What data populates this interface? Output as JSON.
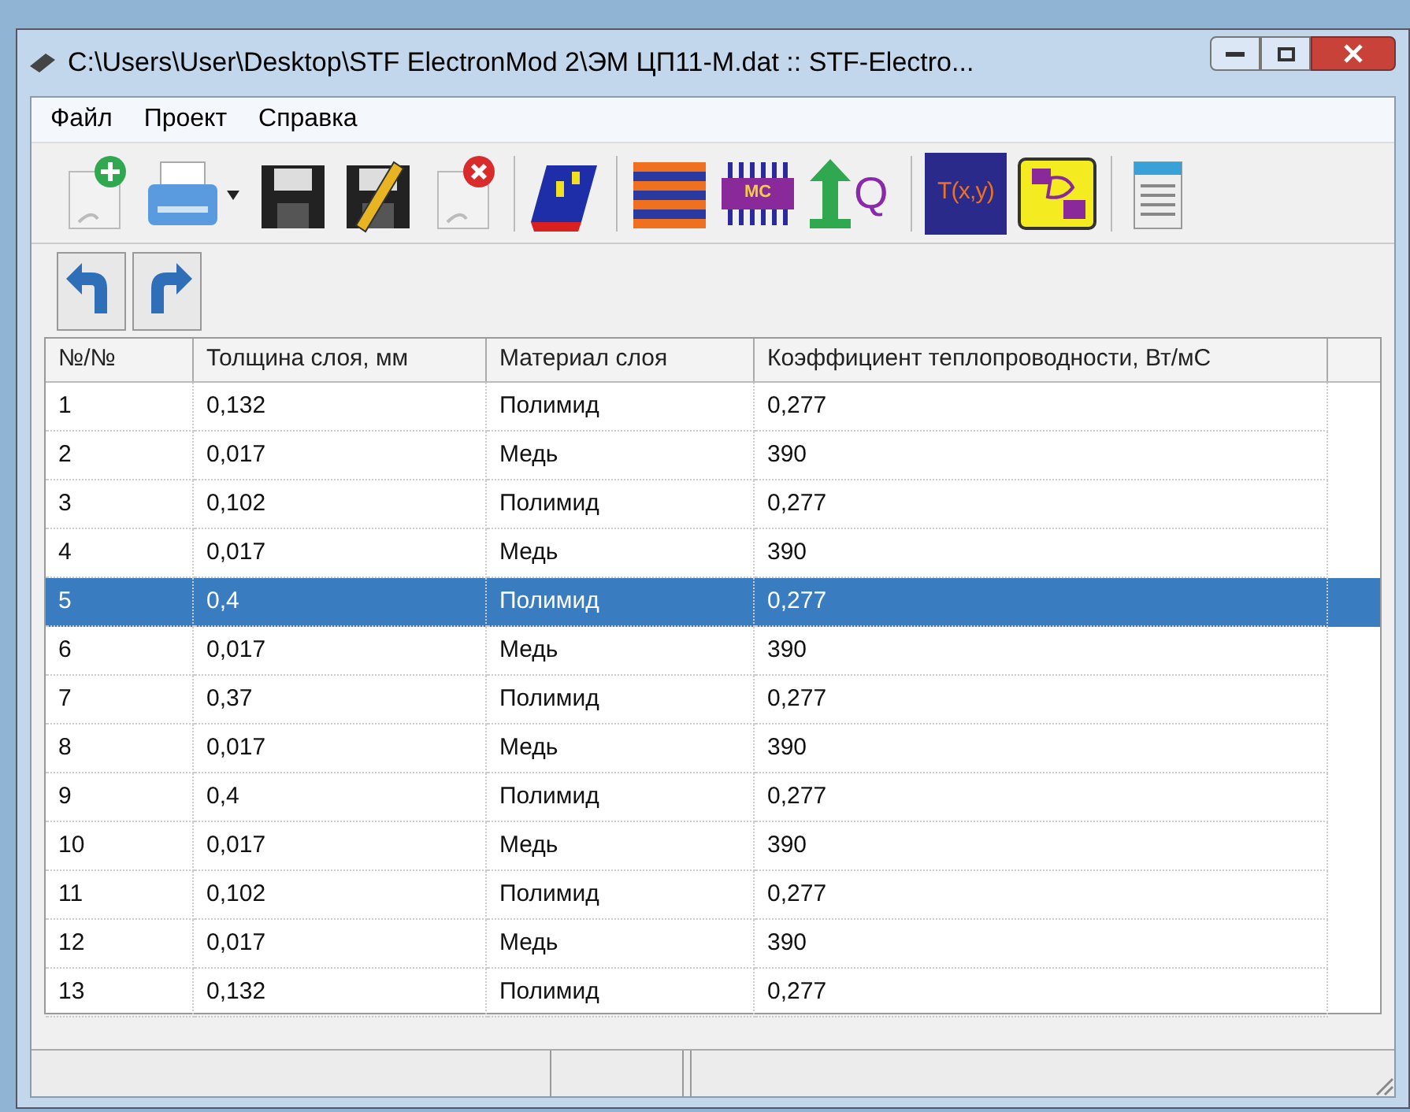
{
  "window": {
    "title": "C:\\Users\\User\\Desktop\\STF ElectronMod 2\\ЭМ ЦП11-М.dat :: STF-Electro..."
  },
  "menu": [
    "Файл",
    "Проект",
    "Справка"
  ],
  "toolbar": [
    {
      "kind": "new"
    },
    {
      "kind": "print"
    },
    {
      "kind": "save"
    },
    {
      "kind": "save-edit"
    },
    {
      "kind": "delete"
    },
    {
      "kind": "sep"
    },
    {
      "kind": "layer"
    },
    {
      "kind": "sep"
    },
    {
      "kind": "stack"
    },
    {
      "kind": "chip",
      "label": "MC"
    },
    {
      "kind": "arrow",
      "label": "Q"
    },
    {
      "kind": "sep"
    },
    {
      "kind": "func",
      "label": "T(x,y)"
    },
    {
      "kind": "board"
    },
    {
      "kind": "sep"
    },
    {
      "kind": "doc"
    }
  ],
  "toolbar2": [
    {
      "kind": "undo"
    },
    {
      "kind": "redo"
    }
  ],
  "table": {
    "columns": [
      "№/№",
      "Толщина слоя, мм",
      "Материал слоя",
      "Коэффициент теплопроводности, Вт/мС"
    ],
    "rows": [
      {
        "cells": [
          "1",
          "0,132",
          "Полимид",
          "0,277"
        ],
        "selected": false
      },
      {
        "cells": [
          "2",
          "0,017",
          "Медь",
          "390"
        ],
        "selected": false
      },
      {
        "cells": [
          "3",
          "0,102",
          "Полимид",
          "0,277"
        ],
        "selected": false
      },
      {
        "cells": [
          "4",
          "0,017",
          "Медь",
          "390"
        ],
        "selected": false
      },
      {
        "cells": [
          "5",
          "0,4",
          "Полимид",
          "0,277"
        ],
        "selected": true
      },
      {
        "cells": [
          "6",
          "0,017",
          "Медь",
          "390"
        ],
        "selected": false
      },
      {
        "cells": [
          "7",
          "0,37",
          "Полимид",
          "0,277"
        ],
        "selected": false
      },
      {
        "cells": [
          "8",
          "0,017",
          "Медь",
          "390"
        ],
        "selected": false
      },
      {
        "cells": [
          "9",
          "0,4",
          "Полимид",
          "0,277"
        ],
        "selected": false
      },
      {
        "cells": [
          "10",
          "0,017",
          "Медь",
          "390"
        ],
        "selected": false
      },
      {
        "cells": [
          "11",
          "0,102",
          "Полимид",
          "0,277"
        ],
        "selected": false
      },
      {
        "cells": [
          "12",
          "0,017",
          "Медь",
          "390"
        ],
        "selected": false
      },
      {
        "cells": [
          "13",
          "0,132",
          "Полимид",
          "0,277"
        ],
        "selected": false
      }
    ]
  }
}
